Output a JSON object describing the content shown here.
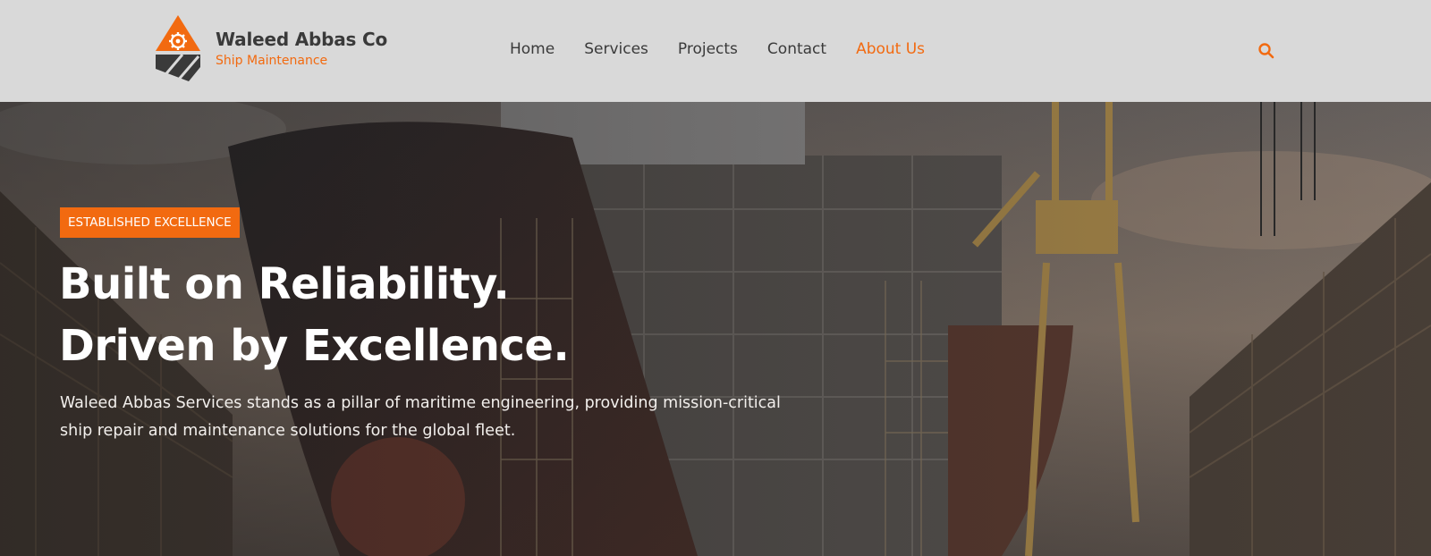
{
  "brand": {
    "name": "Waleed Abbas Co",
    "tagline": "Ship Maintenance",
    "logo_icon": "gear-triangle-logo"
  },
  "nav": {
    "items": [
      {
        "label": "Home",
        "active": false
      },
      {
        "label": "Services",
        "active": false
      },
      {
        "label": "Projects",
        "active": false
      },
      {
        "label": "Contact",
        "active": false
      },
      {
        "label": "About Us",
        "active": true
      }
    ],
    "search_icon": "search-icon"
  },
  "hero": {
    "badge": "ESTABLISHED EXCELLENCE",
    "headline_line1": "Built on Reliability.",
    "headline_line2": "Driven by Excellence.",
    "description": "Waleed Abbas Services stands as a pillar of maritime engineering, providing mission-critical ship repair and maintenance solutions for the global fleet."
  },
  "colors": {
    "accent": "#f26a10",
    "header_bg": "#d9d9d9",
    "text_dark": "#3a3a3a",
    "hero_text": "#ffffff"
  }
}
